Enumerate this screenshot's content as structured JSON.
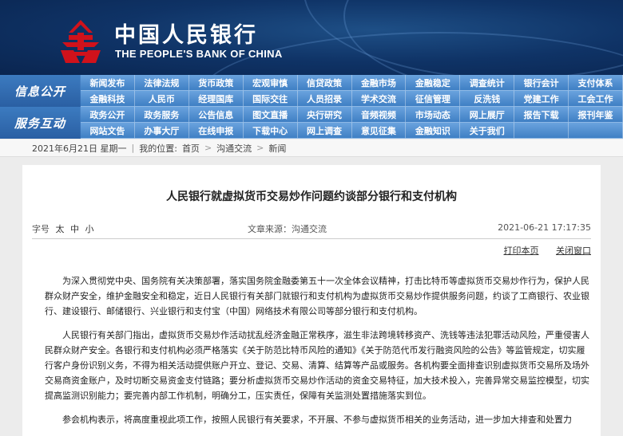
{
  "header": {
    "cn_name": "中国人民银行",
    "en_name": "THE PEOPLE'S BANK OF CHINA",
    "logo": "pboc-logo-icon",
    "colors": {
      "banner": "#0f3366",
      "nav": "#3f7fc4",
      "logo_red": "#d0121b"
    }
  },
  "nav": {
    "section1_label": "信息公开",
    "section1_items": [
      "新闻发布",
      "法律法规",
      "货币政策",
      "宏观审慎",
      "信贷政策",
      "金融市场",
      "金融稳定",
      "调查统计",
      "银行会计",
      "支付体系",
      "金融科技",
      "人民币",
      "经理国库",
      "国际交往",
      "人员招录",
      "学术交流",
      "征信管理",
      "反洗钱",
      "党建工作",
      "工会工作"
    ],
    "section2_label": "服务互动",
    "section2_items": [
      "政务公开",
      "政务服务",
      "公告信息",
      "图文直播",
      "央行研究",
      "音频视频",
      "市场动态",
      "网上展厅",
      "报告下载",
      "报刊年鉴",
      "网站文告",
      "办事大厅",
      "在线申报",
      "下载中心",
      "网上调查",
      "意见征集",
      "金融知识",
      "关于我们",
      "",
      ""
    ]
  },
  "breadcrumb": {
    "date": "2021年6月21日 星期一",
    "location_label": "我的位置:",
    "home": "首页",
    "level1": "沟通交流",
    "level2": "新闻"
  },
  "article": {
    "title": "人民银行就虚拟货币交易炒作问题约谈部分银行和支付机构",
    "font_size_label": "字号",
    "font_sizes": [
      "太",
      "中",
      "小"
    ],
    "source": "文章来源：沟通交流",
    "datetime": "2021-06-21  17:17:35",
    "print_label": "打印本页",
    "close_label": "关闭窗口",
    "paragraphs": [
      "为深入贯彻党中央、国务院有关决策部署，落实国务院金融委第五十一次全体会议精神，打击比特币等虚拟货币交易炒作行为，保护人民群众财产安全，维护金融安全和稳定，近日人民银行有关部门就银行和支付机构为虚拟货币交易炒作提供服务问题，约谈了工商银行、农业银行、建设银行、邮储银行、兴业银行和支付宝（中国）网络技术有限公司等部分银行和支付机构。",
      "人民银行有关部门指出，虚拟货币交易炒作活动扰乱经济金融正常秩序，滋生非法跨境转移资产、洗钱等违法犯罪活动风险，严重侵害人民群众财产安全。各银行和支付机构必须严格落实《关于防范比特币风险的通知》《关于防范代币发行融资风险的公告》等监管规定，切实履行客户身份识别义务，不得为相关活动提供账户开立、登记、交易、清算、结算等产品或服务。各机构要全面排查识别虚拟货币交易所及场外交易商资金账户，及时切断交易资金支付链路；要分析虚拟货币交易炒作活动的资金交易特征，加大技术投入，完善异常交易监控模型，切实提高监测识别能力；要完善内部工作机制，明确分工，压实责任，保障有关监测处置措施落实到位。",
      "参会机构表示，将高度重视此项工作，按照人民银行有关要求，不开展、不参与虚拟货币相关的业务活动，进一步加大排查和处置力"
    ]
  }
}
